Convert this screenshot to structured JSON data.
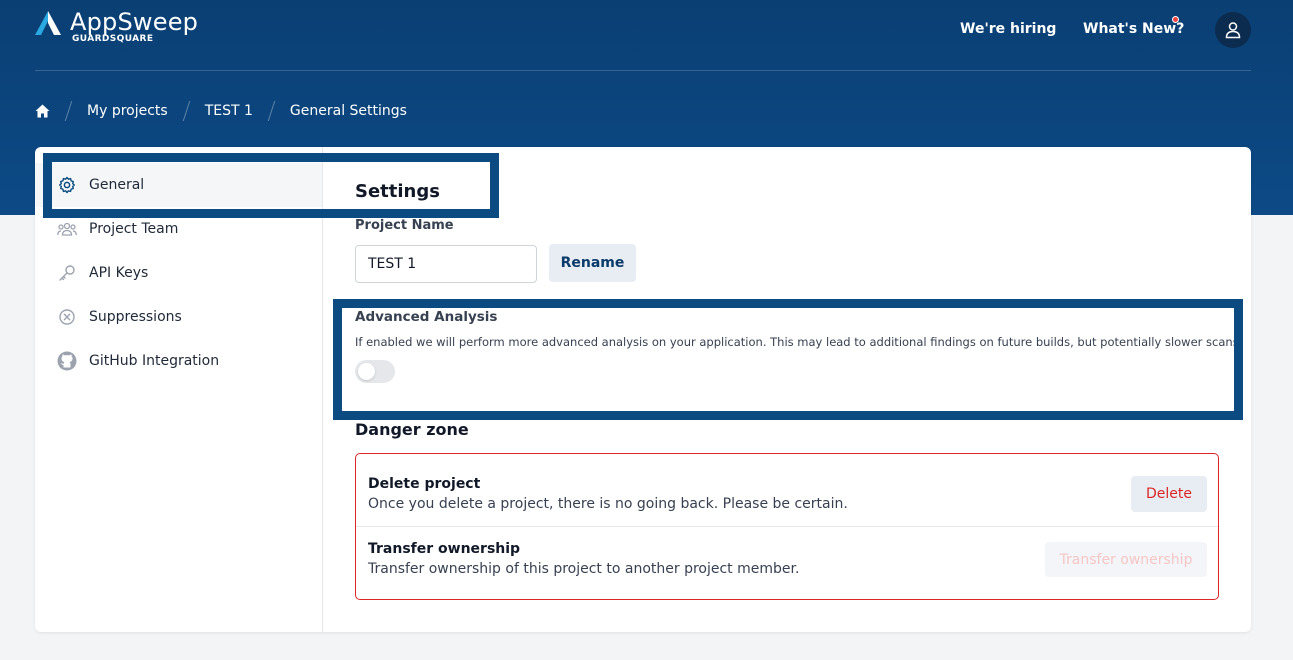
{
  "brand": {
    "name": "AppSweep",
    "sub": "GUARDSQUARE"
  },
  "nav": {
    "hiring": "We're hiring",
    "whats_new": "What's New?"
  },
  "breadcrumb": {
    "p1": "My projects",
    "p2": "TEST 1",
    "p3": "General Settings"
  },
  "sidebar": {
    "general": "General",
    "team": "Project Team",
    "api": "API Keys",
    "suppressions": "Suppressions",
    "github": "GitHub Integration"
  },
  "settings": {
    "title": "Settings",
    "project_name_label": "Project Name",
    "project_name_value": "TEST 1",
    "rename_label": "Rename",
    "advanced_title": "Advanced Analysis",
    "advanced_desc": "If enabled we will perform more advanced analysis on your application. This may lead to additional findings on future builds, but potentially slower scans.",
    "advanced_enabled": false
  },
  "danger": {
    "title": "Danger zone",
    "delete_title": "Delete project",
    "delete_desc": "Once you delete a project, there is no going back. Please be certain.",
    "delete_label": "Delete",
    "transfer_title": "Transfer ownership",
    "transfer_desc": "Transfer ownership of this project to another project member.",
    "transfer_label": "Transfer ownership"
  },
  "colors": {
    "header": "#0d4a86",
    "accent": "#0b4b82",
    "danger": "#dc2626"
  }
}
